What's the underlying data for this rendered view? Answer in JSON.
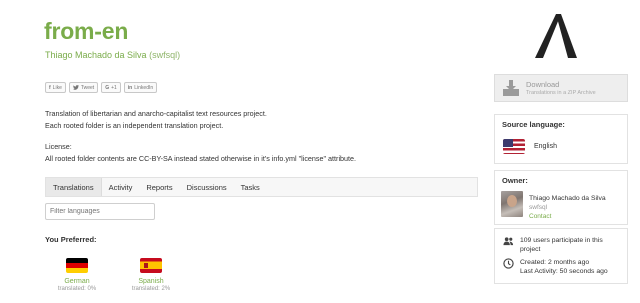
{
  "project": {
    "title": "from-en",
    "owner_name": "Thiago Machado da Silva",
    "owner_handle": "(swfsql)"
  },
  "share_buttons": [
    {
      "icon": "facebook-icon",
      "label": "Like"
    },
    {
      "icon": "twitter-icon",
      "label": "Tweet"
    },
    {
      "icon": "google-plus-icon",
      "label": "+1"
    },
    {
      "icon": "linkedin-icon",
      "label": "LinkedIn"
    }
  ],
  "description": {
    "line1": "Translation of libertarian and anarcho-capitalist text resources project.",
    "line2": "Each rooted folder is an independent translation project.",
    "license_label": "License:",
    "license_text": "All rooted folder contents are CC-BY-SA instead stated otherwise in it's info.yml \"license\" attribute."
  },
  "tabs": [
    "Translations",
    "Activity",
    "Reports",
    "Discussions",
    "Tasks"
  ],
  "active_tab": "Translations",
  "filter": {
    "placeholder": "Filter languages"
  },
  "preferred": {
    "title": "You Preferred:",
    "languages": [
      {
        "name": "German",
        "progress": "translated: 0%",
        "flag": "flag-de"
      },
      {
        "name": "Spanish",
        "progress": "translated: 2%",
        "flag": "flag-es"
      }
    ]
  },
  "download": {
    "label": "Download",
    "sub": "Translations in a ZIP Archive"
  },
  "source": {
    "heading": "Source language:",
    "language": "English",
    "flag": "flag-us"
  },
  "owner": {
    "heading": "Owner:",
    "name": "Thiago Machado da Silva",
    "handle": "swfsql",
    "contact": "Contact"
  },
  "stats": {
    "participants": "109 users participate in this project",
    "created": "Created: 2 months ago",
    "last_activity": "Last Activity: 50 seconds ago"
  },
  "colors": {
    "accent": "#7aac4a",
    "text": "#333333",
    "muted": "#999999"
  }
}
